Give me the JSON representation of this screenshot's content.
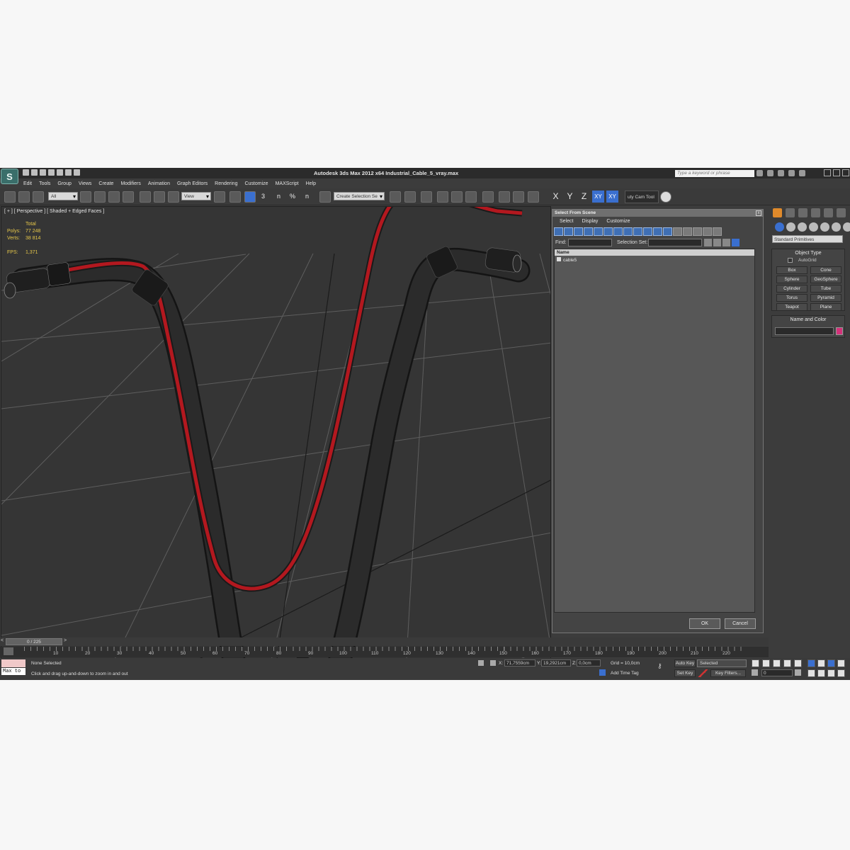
{
  "window": {
    "title": "Autodesk 3ds Max  2012 x64     Industrial_Cable_5_vray.max",
    "logo_text": "S",
    "search_placeholder": "Type a keyword or phrase"
  },
  "menu": [
    "Edit",
    "Tools",
    "Group",
    "Views",
    "Create",
    "Modifiers",
    "Animation",
    "Graph Editors",
    "Rendering",
    "Customize",
    "MAXScript",
    "Help"
  ],
  "toolbar": {
    "filter_value": "All",
    "view_value": "View",
    "selection_set_value": "Create Selection Se",
    "axis_x": "X",
    "axis_y": "Y",
    "axis_z": "Z",
    "axis_xy": "XY",
    "axis_xy2": "XY",
    "custom_tool_label": "uty Cam Tool",
    "snap_label": "3",
    "angle_snap_label": "n",
    "percent_snap_label": "%",
    "spinner_snap_label": "n"
  },
  "viewport": {
    "label": "[ + ] [ Perspective ] [ Shaded + Edged Faces ]",
    "stats": {
      "total_label": "Total",
      "polys_label": "Polys:",
      "polys_value": "77 248",
      "verts_label": "Verts:",
      "verts_value": "38 814",
      "fps_label": "FPS:",
      "fps_value": "1,371"
    }
  },
  "dialog": {
    "title": "Select From Scene",
    "close": "x",
    "menu": [
      "Select",
      "Display",
      "Customize"
    ],
    "find_label": "Find:",
    "selection_set_label": "Selection Set:",
    "column_name": "Name",
    "items": [
      "cable5"
    ],
    "ok_label": "OK",
    "cancel_label": "Cancel"
  },
  "command_panel": {
    "dropdown": "Standard Primitives",
    "object_type_title": "Object Type",
    "autogrid_label": "AutoGrid",
    "primitives": [
      "Box",
      "Cone",
      "Sphere",
      "GeoSphere",
      "Cylinder",
      "Tube",
      "Torus",
      "Pyramid",
      "Teapot",
      "Plane"
    ],
    "name_color_title": "Name and Color",
    "object_color": "#d4317a"
  },
  "timeline": {
    "frame_display": "0 / 225",
    "prev": "<",
    "next": ">",
    "ruler_labels": [
      "10",
      "20",
      "30",
      "40",
      "50",
      "60",
      "70",
      "80",
      "90",
      "100",
      "110",
      "120",
      "130",
      "140",
      "150",
      "160",
      "170",
      "180",
      "190",
      "200",
      "210",
      "220"
    ]
  },
  "status": {
    "maxscript_text": "Max to",
    "selection_text": "None Selected",
    "prompt_text": "Click and drag up-and-down to zoom in and out",
    "x_label": "X:",
    "x_value": "71,7559cm",
    "y_label": "Y:",
    "y_value": "19,2921cm",
    "z_label": "Z:",
    "z_value": "0,0cm",
    "grid_text": "Grid = 10,0cm",
    "add_time_tag": "Add Time Tag",
    "auto_key": "Auto Key",
    "selected_value": "Selected",
    "set_key": "Set Key",
    "key_filters": "Key Filters...",
    "frame_value": "0"
  }
}
